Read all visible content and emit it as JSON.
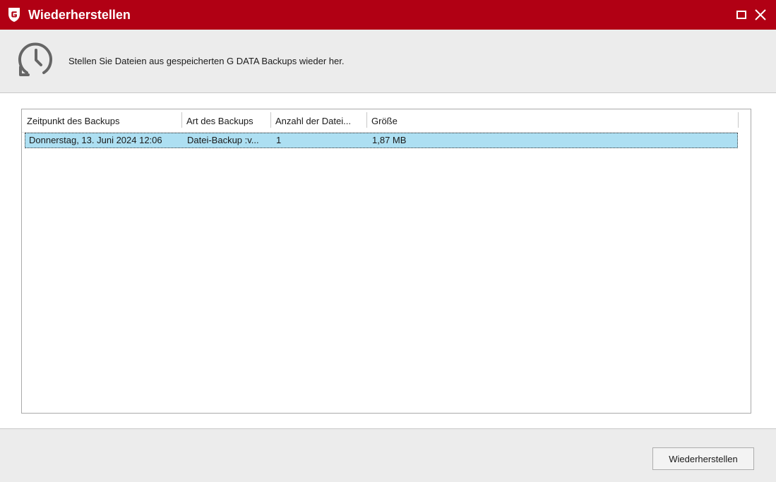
{
  "window": {
    "title": "Wiederherstellen",
    "logo_icon": "gdata-shield-g-icon",
    "maximize_icon": "maximize-icon",
    "close_icon": "close-icon",
    "accent_color": "#b10014"
  },
  "header": {
    "icon": "restore-history-icon",
    "text": "Stellen Sie Dateien aus gespeicherten G DATA Backups wieder her."
  },
  "backup_list": {
    "columns": [
      "Zeitpunkt des Backups",
      "Art des Backups",
      "Anzahl der Datei...",
      "Größe"
    ],
    "rows": [
      {
        "timestamp": "Donnerstag, 13. Juni 2024 12:06",
        "type": "Datei-Backup :v...",
        "file_count": "1",
        "size": "1,87 MB",
        "selected": true
      }
    ],
    "selection_color": "#addff2"
  },
  "footer": {
    "restore_button_label": "Wiederherstellen"
  }
}
